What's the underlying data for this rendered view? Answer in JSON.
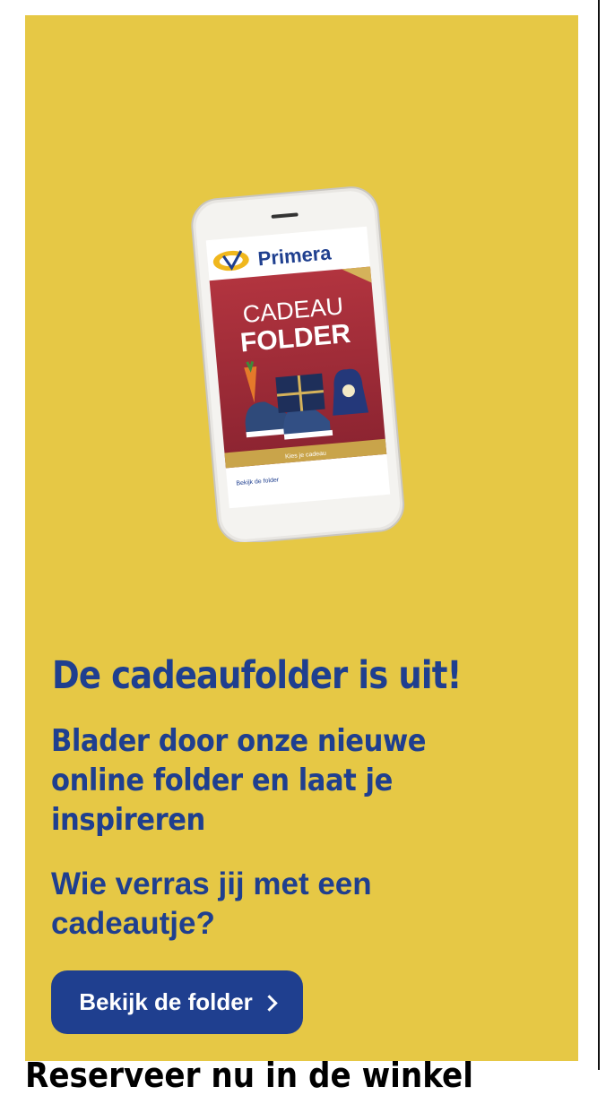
{
  "promo": {
    "headline": "De cadeaufolder is uit!",
    "subheadline": "Blader door onze nieuwe online folder en laat je inspireren",
    "question": "Wie verras jij met een cadeautje?",
    "cta_label": "Bekijk de folder",
    "cta_icon": "chevron-right-icon"
  },
  "phone_screen": {
    "brand": "Primera",
    "folder_line1": "CADEAU",
    "folder_line2": "FOLDER",
    "footer_text": "Kies je cadeau",
    "link_text": "Bekijk de folder"
  },
  "next_section": {
    "heading": "Reserveer nu in de winkel"
  },
  "colors": {
    "background": "#e6c845",
    "brand_blue": "#1f3f8f",
    "folder_red": "#a3303b"
  }
}
